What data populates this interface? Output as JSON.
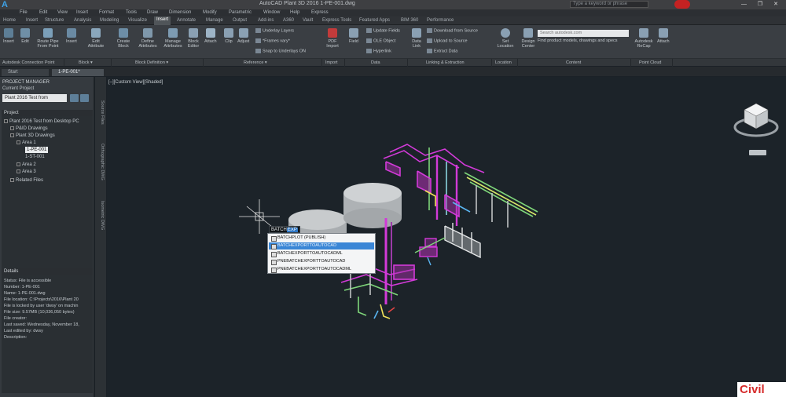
{
  "titlebar": {
    "title": "AutoCAD Plant 3D 2016   1-PE-001.dwg",
    "search_placeholder": "Type a keyword or phrase",
    "window_buttons": "— ❐ ✕"
  },
  "menu": [
    "File",
    "Edit",
    "View",
    "Insert",
    "Format",
    "Tools",
    "Draw",
    "Dimension",
    "Modify",
    "Parametric",
    "Window",
    "Help",
    "Express"
  ],
  "ribbon_tabs": [
    {
      "label": "Home"
    },
    {
      "label": "Insert",
      "active": false
    },
    {
      "label": "Structure"
    },
    {
      "label": "Analysis"
    },
    {
      "label": "Modeling"
    },
    {
      "label": "Visualize"
    },
    {
      "label": "Insert",
      "active": true
    },
    {
      "label": "Annotate"
    },
    {
      "label": "Manage"
    },
    {
      "label": "Output"
    },
    {
      "label": "Add-ins"
    },
    {
      "label": "A360"
    },
    {
      "label": "Vault"
    },
    {
      "label": "Express Tools"
    },
    {
      "label": "Featured Apps"
    },
    {
      "label": "BIM 360"
    },
    {
      "label": "Performance"
    }
  ],
  "ribbon": {
    "buttons": [
      {
        "label": "Insert",
        "color": "#5d7e96"
      },
      {
        "label": "Edit",
        "color": "#6f8fa6"
      },
      {
        "label": "Route Pipe From Point",
        "color": "#7b9fb9"
      },
      {
        "label": "Insert",
        "color": "#6a8aa3"
      },
      {
        "label": "Edit Attribute",
        "color": "#8aa7bc"
      },
      {
        "label": "Create Block",
        "color": "#6d8ea7"
      },
      {
        "label": "Define Attributes",
        "color": "#7f98ab"
      },
      {
        "label": "Manage Attributes",
        "color": "#7d9bb2"
      },
      {
        "label": "Block Editor",
        "color": "#8aa0b3"
      },
      {
        "label": "Attach",
        "color": "#9db4c6"
      },
      {
        "label": "Clip",
        "color": "#8aa0b3"
      },
      {
        "label": "Adjust",
        "color": "#8aa0b3"
      },
      {
        "label": "PDF Import",
        "color": "#c23b3b"
      },
      {
        "label": "Field",
        "color": "#8aa0b3"
      },
      {
        "label": "Data Link",
        "color": "#8aa0b3"
      },
      {
        "label": "Set Location",
        "color": "#8aa0b3"
      },
      {
        "label": "Design Center",
        "color": "#8aa0b3"
      },
      {
        "label": "Autodesk ReCap",
        "color": "#8aa0b3"
      },
      {
        "label": "Attach",
        "color": "#8aa0b3"
      }
    ],
    "small_buttons": [
      "Underlay Layers",
      "*Frames vary*",
      "Snap to Underlays ON",
      "Update Fields",
      "OLE Object",
      "Hyperlink",
      "Download from Source",
      "Upload to Source",
      "Extract  Data"
    ],
    "content_search_placeholder": "Search autodesk.com",
    "content_desc": "Find product models, drawings and specs",
    "panel_labels": [
      "Autodesk Connection Point",
      "Block ▾",
      "Block Definition ▾",
      "Reference ▾",
      "Import",
      "Data",
      "Linking & Extraction",
      "Location",
      "Content",
      "Point Cloud"
    ]
  },
  "doc_tabs": [
    {
      "label": "Start",
      "active": false
    },
    {
      "label": "1-PE-001*",
      "active": true
    }
  ],
  "project_manager": {
    "title": "PROJECT MANAGER",
    "current_project_label": "Current Project",
    "current_project": "Plant 2016 Test from",
    "project_section": "Project",
    "tree": [
      {
        "label": "Plant 2016 Test from Desktop PC",
        "indent": 0
      },
      {
        "label": "P&ID Drawings",
        "indent": 1
      },
      {
        "label": "Plant 3D Drawings",
        "indent": 1
      },
      {
        "label": "Area 1",
        "indent": 2
      },
      {
        "label": "1-PE-001",
        "indent": 3,
        "selected": true
      },
      {
        "label": "1-ST-001",
        "indent": 3
      },
      {
        "label": "Area 2",
        "indent": 2
      },
      {
        "label": "Area 3",
        "indent": 2
      },
      {
        "label": "Related Files",
        "indent": 1
      }
    ],
    "details_section": "Details",
    "details": [
      "Status: File is accessible",
      "Number: 1-PE-001",
      "Name: 1-PE-001.dwg",
      "File location: C:\\Projects\\2016\\Plant 20",
      "File is locked by user 'dwsy' on machin",
      "File size: 9.57MB (10,036,050 bytes)",
      "File creator:",
      "Last saved: Wednesday, November 18,",
      "Last edited by: dwsy",
      "Description:"
    ],
    "vertical_tabs": [
      "Source Files",
      "Orthographic DWG",
      "Isometric DWG"
    ]
  },
  "viewport": {
    "label": "[–][Custom View][Shaded]"
  },
  "command": {
    "typed": "BATCH",
    "typed_highlight": "EXP",
    "suggestions": [
      {
        "label": "BATCHPLOT (PUBLISH)",
        "hovered": false
      },
      {
        "label": "BATCHEXPORTTOAUTOCAD",
        "hovered": true
      },
      {
        "label": "BATCHEXPORTTOAUTOCADML",
        "hovered": false
      },
      {
        "label": "PNEBATCHEXPORTTOAUTOCAD",
        "hovered": false
      },
      {
        "label": "PNEBATCHEXPORTTOAUTOCADML",
        "hovered": false
      }
    ]
  },
  "watermark": {
    "text": "Civil"
  },
  "colors": {
    "viewport_bg": "#1c2329",
    "pipe_magenta": "#d23ad8",
    "pipe_green": "#7fd67a",
    "tank_gray": "#b9bcbe",
    "accent_blue": "#3a86d6"
  }
}
